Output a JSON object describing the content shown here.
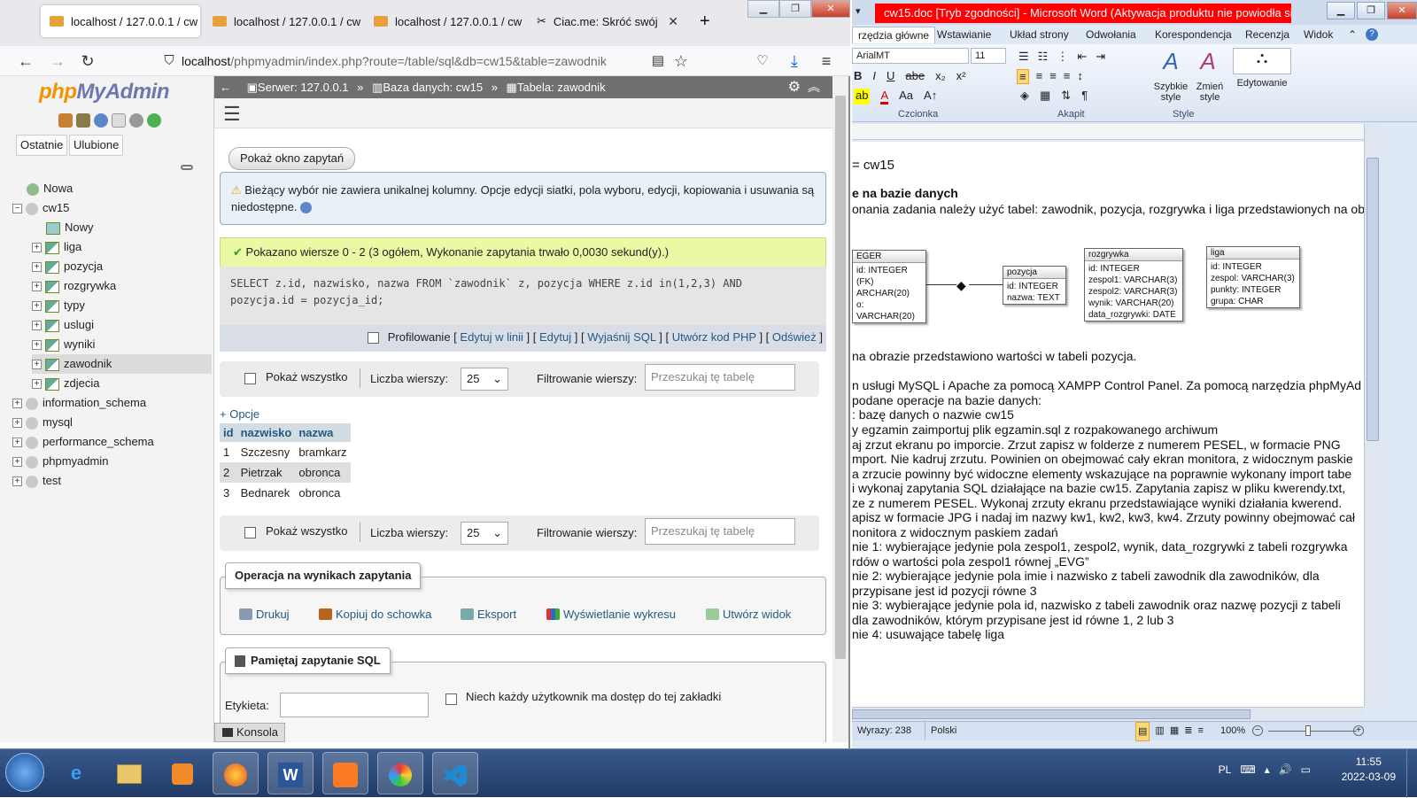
{
  "browser": {
    "tabs": [
      {
        "label": "localhost / 127.0.0.1 / cw"
      },
      {
        "label": "localhost / 127.0.0.1 / cw"
      },
      {
        "label": "localhost / 127.0.0.1 / cw"
      },
      {
        "label": "Ciac.me: Skróć swój"
      }
    ],
    "url_host": "localhost",
    "url_path": "/phpmyadmin/index.php?route=/table/sql&db=cw15&table=zawodnik"
  },
  "pma": {
    "logo_a": "php",
    "logo_b": "MyAdmin",
    "recent": "Ostatnie",
    "favorites": "Ulubione",
    "tree": [
      {
        "label": "Nowa",
        "depth": 0
      },
      {
        "label": "cw15",
        "depth": 0
      },
      {
        "label": "Nowy",
        "depth": 1
      },
      {
        "label": "liga",
        "depth": 1
      },
      {
        "label": "pozycja",
        "depth": 1
      },
      {
        "label": "rozgrywka",
        "depth": 1
      },
      {
        "label": "typy",
        "depth": 1
      },
      {
        "label": "uslugi",
        "depth": 1
      },
      {
        "label": "wyniki",
        "depth": 1
      },
      {
        "label": "zawodnik",
        "depth": 1
      },
      {
        "label": "zdjecia",
        "depth": 1
      },
      {
        "label": "information_schema",
        "depth": 0
      },
      {
        "label": "mysql",
        "depth": 0
      },
      {
        "label": "performance_schema",
        "depth": 0
      },
      {
        "label": "phpmyadmin",
        "depth": 0
      },
      {
        "label": "test",
        "depth": 0
      }
    ],
    "breadcrumb": {
      "server": "Serwer: 127.0.0.1",
      "db": "Baza danych: cw15",
      "table": "Tabela: zawodnik"
    },
    "show_query_btn": "Pokaż okno zapytań",
    "warning": "Bieżący wybór nie zawiera unikalnej kolumny. Opcje edycji siatki, pola wyboru, edycji, kopiowania i usuwania są niedostępne.",
    "success": "Pokazano wiersze 0 - 2 (3 ogółem, Wykonanie zapytania trwało 0,0030 sekund(y).)",
    "sql_line1": "SELECT z.id, nazwisko, nazwa FROM `zawodnik` z, pozycja WHERE z.id in(1,2,3) AND",
    "sql_line2": "pozycja.id = pozycja_id;",
    "profiling": "Profilowanie",
    "links": [
      "Edytuj w linii",
      "Edytuj",
      "Wyjaśnij SQL",
      "Utwórz kod PHP",
      "Odśwież"
    ],
    "show_all": "Pokaż wszystko",
    "rows_label": "Liczba wierszy:",
    "rows_value": "25",
    "filter_label": "Filtrowanie wierszy:",
    "filter_placeholder": "Przeszukaj tę tabelę",
    "options": "+ Opcje",
    "columns": [
      "id",
      "nazwisko",
      "nazwa"
    ],
    "rows": [
      [
        "1",
        "Szczesny",
        "bramkarz"
      ],
      [
        "2",
        "Pietrzak",
        "obronca"
      ],
      [
        "3",
        "Bednarek",
        "obronca"
      ]
    ],
    "ops_title": "Operacja na wynikach zapytania",
    "ops": [
      "Drukuj",
      "Kopiuj do schowka",
      "Eksport",
      "Wyświetlanie wykresu",
      "Utwórz widok"
    ],
    "bookmark_title": "Pamiętaj zapytanie SQL",
    "label_field": "Etykieta:",
    "share_label": "Niech każdy użytkownik ma dostęp do tej zakładki",
    "console": "Konsola"
  },
  "word": {
    "title": "cw15.doc [Tryb zgodności] - Microsoft Word (Aktywacja produktu nie powiodła się)",
    "tabs": [
      "rzędzia główne",
      "Wstawianie",
      "Układ strony",
      "Odwołania",
      "Korespondencja",
      "Recenzja",
      "Widok"
    ],
    "font": "ArialMT",
    "size": "11",
    "groups": [
      "Czcionka",
      "Akapit",
      "Style"
    ],
    "style_btns": [
      "Szybkie style",
      "Zmień style",
      "Edytowanie"
    ],
    "doc": [
      "= cw15",
      "e na bazie danych",
      "onania zadania należy użyć tabel: zawodnik, pozycja, rozgrywka i liga przedstawionych na ob",
      "na obrazie przedstawiono wartości w tabeli pozycja.",
      "n usługi MySQL i Apache za pomocą XAMPP Control Panel. Za pomocą narzędzia phpMyAd",
      "podane operacje na bazie danych:",
      ": bazę danych o nazwie cw15",
      "y egzamin zaimportuj plik egzamin.sql z rozpakowanego archiwum",
      "aj zrzut ekranu po imporcie. Zrzut zapisz w folderze z numerem PESEL, w formacie PNG",
      "mport. Nie kadruj zrzutu. Powinien on obejmować cały ekran monitora, z widocznym paskie",
      "a zrzucie powinny być widoczne elementy wskazujące na poprawnie wykonany import tabe",
      "i wykonaj zapytania SQL działające na bazie cw15. Zapytania zapisz w pliku kwerendy.txt,",
      "ze z numerem PESEL. Wykonaj zrzuty ekranu przedstawiające wyniki działania  kwerend.",
      "apisz w formacie JPG i nadaj im nazwy kw1, kw2, kw3, kw4. Zrzuty powinny obejmować cał",
      "nonitora z widocznym paskiem zadań",
      "nie 1: wybierające jedynie pola zespol1, zespol2, wynik, data_rozgrywki z tabeli rozgrywka",
      "rdów o wartości pola zespol1 równej „EVG”",
      "nie 2: wybierające jedynie pola imie i nazwisko z tabeli zawodnik dla zawodników, dla",
      "przypisane jest id pozycji równe 3",
      "nie 3: wybierające jedynie pola id, nazwisko z tabeli zawodnik oraz nazwę pozycji z tabeli",
      "dla zawodników, którym przypisane jest id równe 1, 2 lub 3",
      "nie 4: usuwające tabelę liga"
    ],
    "er": {
      "t1": [
        "EGER",
        "id: INTEGER (FK)",
        "ARCHAR(20)",
        "o: VARCHAR(20)"
      ],
      "pozycja": [
        "pozycja",
        "id: INTEGER",
        "nazwa: TEXT"
      ],
      "rozgrywka": [
        "rozgrywka",
        "id: INTEGER",
        "zespol1: VARCHAR(3)",
        "zespol2: VARCHAR(3)",
        "wynik: VARCHAR(20)",
        "data_rozgrywki: DATE"
      ],
      "liga": [
        "liga",
        "id: INTEGER",
        "zespol: VARCHAR(3)",
        "punkty: INTEGER",
        "grupa: CHAR"
      ]
    },
    "words": "Wyrazy: 238",
    "lang": "Polski",
    "zoom": "100%"
  },
  "taskbar": {
    "lang": "PL",
    "time": "11:55",
    "date": "2022-03-09"
  }
}
